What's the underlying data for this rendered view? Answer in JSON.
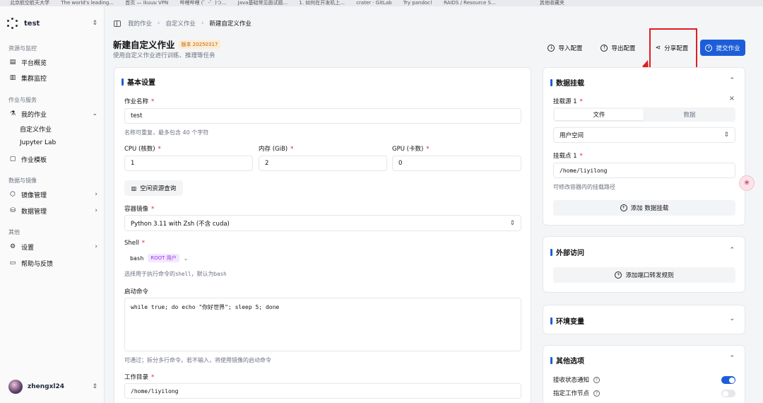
{
  "browser": {
    "bookmarks": [
      "北京航空航天大学",
      "The world's leading...",
      "首页 — ikuuu VPN",
      "哔哩哔哩 (゜-゜)つ...",
      "Java基础常见面试题...",
      "1. 如何在开发机上...",
      "crater · GitLab",
      "Try pandoc!",
      "RAIDS / Resource S...",
      "其他收藏夹"
    ]
  },
  "sidebar": {
    "workspace": "test",
    "sections": {
      "monitor": "资源与监控",
      "jobs": "作业与服务",
      "data": "数据与镜像",
      "other": "其他"
    },
    "items": {
      "overview": "平台概览",
      "cluster": "集群监控",
      "myjobs": "我的作业",
      "custom": "自定义作业",
      "jupyter": "Jupyter Lab",
      "templates": "作业模板",
      "images": "镜像管理",
      "datamgmt": "数据管理",
      "settings": "设置",
      "help": "帮助与反馈"
    },
    "user": "zhengxl24"
  },
  "breadcrumb": [
    "我的作业",
    "自定义作业",
    "新建自定义作业"
  ],
  "page": {
    "title": "新建自定义作业",
    "version": "版本 20250317",
    "subtitle": "使用自定义作业进行训练、推理等任务"
  },
  "toolbar": {
    "import": "导入配置",
    "export": "导出配置",
    "share": "分享配置",
    "submit": "提交作业"
  },
  "basic": {
    "title": "基本设置",
    "name_label": "作业名称",
    "name_value": "test",
    "name_help": "名称可重复，最多包含 40 个字符",
    "cpu_label": "CPU (核数)",
    "cpu_value": "1",
    "mem_label": "内存 (GiB)",
    "mem_value": "2",
    "gpu_label": "GPU (卡数)",
    "gpu_value": "0",
    "idle_btn": "空闲资源查询",
    "image_label": "容器镜像",
    "image_value": "Python 3.11 with Zsh (不含 cuda)",
    "shell_label": "Shell",
    "shell_value": "bash",
    "shell_badge": "ROOT 用户",
    "shell_help_pre": "选择用于执行命令的",
    "shell_help_code1": "shell",
    "shell_help_mid": "，默认为",
    "shell_help_code2": "bash",
    "cmd_label": "启动命令",
    "cmd_value": "while true; do echo \"你好世界\"; sleep 5; done",
    "cmd_help": "可通过；拆分多行命令。若不输入，将使用镜像的启动命令",
    "workdir_label": "工作目录",
    "workdir_value": "/home/liyilong"
  },
  "mount": {
    "title": "数据挂载",
    "source_label": "挂载源 1",
    "tab_file": "文件",
    "tab_data": "数据",
    "space_value": "用户空间",
    "point_label": "挂载点 1",
    "point_value": "/home/liyilong",
    "point_help": "可修改容器内的挂载路径",
    "add_btn": "添加 数据挂载"
  },
  "external": {
    "title": "外部访问",
    "add_btn": "添加端口转发规则"
  },
  "env": {
    "title": "环境变量"
  },
  "other": {
    "title": "其他选项",
    "notify_label": "接收状态通知",
    "notify_on": true,
    "node_label": "指定工作节点",
    "node_on": false
  },
  "colors": {
    "primary": "#1d5ed8",
    "annotation": "#e11d1d"
  }
}
